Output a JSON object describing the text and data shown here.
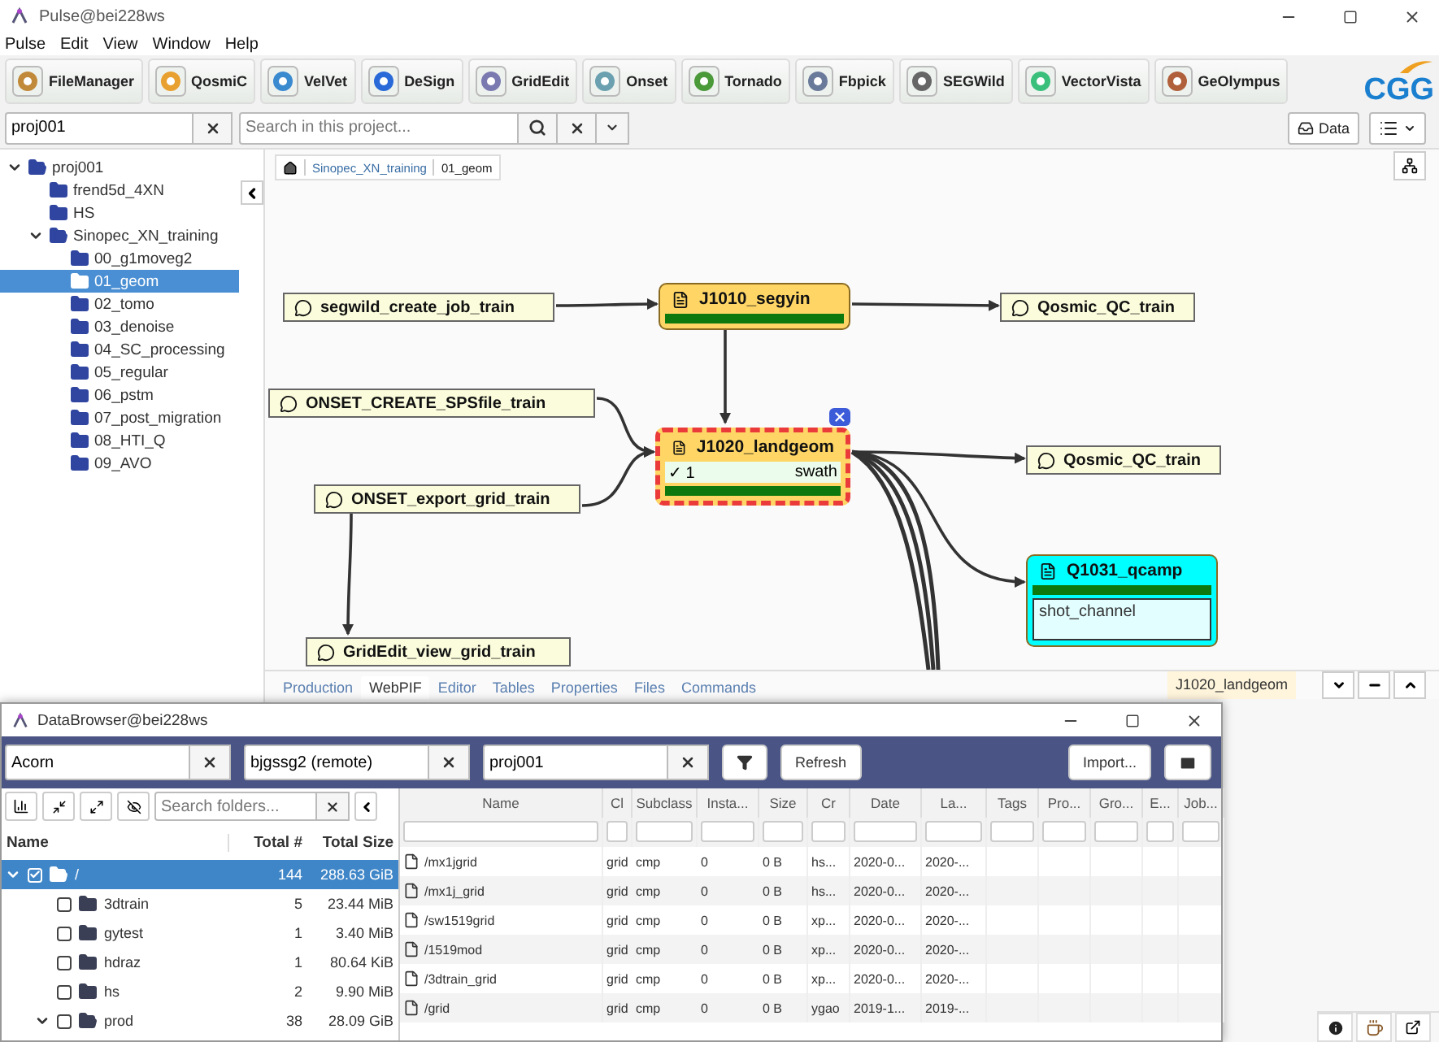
{
  "window": {
    "title": "Pulse@bei228ws"
  },
  "menu": [
    "Pulse",
    "Edit",
    "View",
    "Window",
    "Help"
  ],
  "apps": [
    "FileManager",
    "QosmiC",
    "VelVet",
    "DeSign",
    "GridEdit",
    "Onset",
    "Tornado",
    "Fbpick",
    "SEGWild",
    "VectorVista",
    "GeOlympus"
  ],
  "logo": "CGG",
  "project_field": {
    "value": "proj001"
  },
  "search": {
    "placeholder": "Search in this project..."
  },
  "data_button": "Data",
  "tree": [
    {
      "label": "proj001",
      "expanded": true,
      "selected": false,
      "children": [
        {
          "label": "frend5d_4XN",
          "expanded": false,
          "selected": false
        },
        {
          "label": "HS",
          "expanded": false,
          "selected": false
        },
        {
          "label": "Sinopec_XN_training",
          "expanded": true,
          "selected": false,
          "children": [
            {
              "label": "00_g1moveg2",
              "expanded": false,
              "selected": false
            },
            {
              "label": "01_geom",
              "expanded": false,
              "selected": true
            },
            {
              "label": "02_tomo",
              "expanded": false,
              "selected": false
            },
            {
              "label": "03_denoise",
              "expanded": false,
              "selected": false
            },
            {
              "label": "04_SC_processing",
              "expanded": false,
              "selected": false
            },
            {
              "label": "05_regular",
              "expanded": false,
              "selected": false
            },
            {
              "label": "06_pstm",
              "expanded": false,
              "selected": false
            },
            {
              "label": "07_post_migration",
              "expanded": false,
              "selected": false
            },
            {
              "label": "08_HTI_Q",
              "expanded": false,
              "selected": false
            },
            {
              "label": "09_AVO",
              "expanded": false,
              "selected": false
            }
          ]
        }
      ]
    }
  ],
  "breadcrumb": [
    "Sinopec_XN_training",
    "01_geom"
  ],
  "nodes": [
    {
      "kind": "note",
      "label": "segwild_create_job_train"
    },
    {
      "kind": "job",
      "label": "J1010_segyin",
      "color": "#ffd666",
      "selected": false,
      "level": 1
    },
    {
      "kind": "note",
      "label": "Qosmic_QC_train"
    },
    {
      "kind": "note",
      "label": "ONSET_CREATE_SPSfile_train"
    },
    {
      "kind": "job",
      "label": "J1020_landgeom",
      "color": "#ffd666",
      "selected": true,
      "level": 1,
      "count": "✓ 1",
      "tag": "swath"
    },
    {
      "kind": "note",
      "label": "Qosmic_QC_train"
    },
    {
      "kind": "note",
      "label": "ONSET_export_grid_train"
    },
    {
      "kind": "job",
      "label": "Q1031_qcamp",
      "color": "#00ffff",
      "selected": false,
      "level": 1,
      "output": "shot_channel"
    },
    {
      "kind": "note",
      "label": "GridEdit_view_grid_train"
    }
  ],
  "bottom_tabs": [
    {
      "label": "Production",
      "selected": false
    },
    {
      "label": "WebPIF",
      "selected": true
    },
    {
      "label": "Editor",
      "selected": false
    },
    {
      "label": "Tables",
      "selected": false
    },
    {
      "label": "Properties",
      "selected": false
    },
    {
      "label": "Files",
      "selected": false
    },
    {
      "label": "Commands",
      "selected": false
    }
  ],
  "detail_tab": "J1020_landgeom",
  "data_browser": {
    "title": "DataBrowser@bei228ws",
    "fields": [
      {
        "value": "Acorn"
      },
      {
        "value": "bjgssg2 (remote)"
      },
      {
        "value": "proj001"
      }
    ],
    "refresh": "Refresh",
    "import": "Import...",
    "folder_search": {
      "placeholder": "Search folders..."
    },
    "folder_columns": [
      "Name",
      "Total #",
      "Total Size"
    ],
    "folders": [
      {
        "name": "/",
        "total": "144",
        "size": "288.63 GiB",
        "checked": true,
        "expanded": true,
        "selected": true,
        "children": [
          {
            "name": "3dtrain",
            "total": "5",
            "size": "23.44 MiB",
            "checked": false,
            "expanded": false,
            "selected": false
          },
          {
            "name": "gytest",
            "total": "1",
            "size": "3.40 MiB",
            "checked": false,
            "expanded": false,
            "selected": false
          },
          {
            "name": "hdraz",
            "total": "1",
            "size": "80.64 KiB",
            "checked": false,
            "expanded": false,
            "selected": false
          },
          {
            "name": "hs",
            "total": "2",
            "size": "9.90 MiB",
            "checked": false,
            "expanded": false,
            "selected": false
          },
          {
            "name": "prod",
            "total": "38",
            "size": "28.09 GiB",
            "checked": false,
            "expanded": true,
            "selected": false
          }
        ]
      }
    ],
    "columns": [
      "Name",
      "Cl",
      "Subclass",
      "Insta...",
      "Size",
      "Cr",
      "Date",
      "La...",
      "Tags",
      "Pro...",
      "Gro...",
      "E...",
      "Job..."
    ],
    "rows": [
      [
        "/mx1jgrid",
        "grid",
        "cmp",
        "0",
        "0 B",
        "hs...",
        "2020-0...",
        "2020-..."
      ],
      [
        "/mx1j_grid",
        "grid",
        "cmp",
        "0",
        "0 B",
        "hs...",
        "2020-0...",
        "2020-..."
      ],
      [
        "/sw1519grid",
        "grid",
        "cmp",
        "0",
        "0 B",
        "xp...",
        "2020-0...",
        "2020-..."
      ],
      [
        "/1519mod",
        "grid",
        "cmp",
        "0",
        "0 B",
        "xp...",
        "2020-0...",
        "2020-..."
      ],
      [
        "/3dtrain_grid",
        "grid",
        "cmp",
        "0",
        "0 B",
        "xp...",
        "2020-0...",
        "2020-..."
      ],
      [
        "/grid",
        "grid",
        "cmp",
        "0",
        "0 B",
        "ygao",
        "2019-1...",
        "2019-..."
      ]
    ]
  }
}
